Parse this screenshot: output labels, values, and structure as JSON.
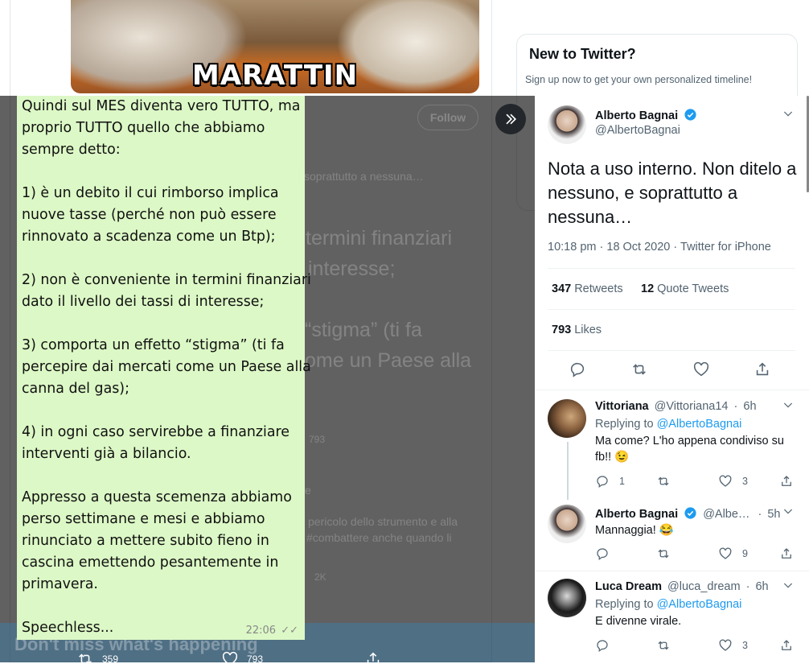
{
  "background": {
    "photo_caption": "MARATTIN",
    "sidebar_title": "New to Twitter?",
    "sidebar_subtitle": "Sign up now to get your own personalized timeline!",
    "follow_label": "Follow",
    "dim_snippets": [
      "soprattutto a nessuna…",
      "termini finanziari",
      "interesse;",
      "“stigma” (ti fa",
      "ome un Paese alla",
      "793",
      "pericolo dello strumento e alla",
      "#combattere anche quando li",
      "2K",
      "e"
    ],
    "banner_text": "Don't miss what's happening"
  },
  "chat_image": {
    "lines": [
      "Quindi sul MES diventa vero TUTTO, ma",
      "proprio TUTTO quello che abbiamo",
      "sempre detto:",
      "",
      "1) è un debito il cui rimborso implica",
      "nuove tasse (perché non può essere",
      "rinnovato a scadenza come un Btp);",
      "",
      "2) non è conveniente in termini finanziari",
      "dato il livello dei tassi di interesse;",
      "",
      "3) comporta un effetto “stigma” (ti fa",
      "percepire dai mercati come un Paese alla",
      "canna del gas);",
      "",
      "4) in ogni caso servirebbe a finanziare",
      "interventi già a bilancio.",
      "",
      "Appresso a questa scemenza abbiamo",
      "perso settimane e mesi e abbiamo",
      "rinunciato a mettere subito fieno in",
      "cascina emettendo pesantemente in",
      "primavera.",
      "",
      "Speechless..."
    ],
    "time": "22:06",
    "ticks": "✓✓"
  },
  "image_viewer_bar": {
    "retweets": "359",
    "likes": "793"
  },
  "tweet": {
    "author_name": "Alberto Bagnai",
    "author_handle": "@AlbertoBagnai",
    "text": "Nota a uso interno. Non ditelo a nessuno, e soprattutto a nessuna…",
    "time": "10:18 pm",
    "date": "18 Oct 2020",
    "source": "Twitter for iPhone",
    "retweets_count": "347",
    "retweets_label": "Retweets",
    "quotes_count": "12",
    "quotes_label": "Quote Tweets",
    "likes_count": "793",
    "likes_label": "Likes"
  },
  "replies": [
    {
      "name": "Vittoriana",
      "handle": "@Vittoriana14",
      "age": "6h",
      "replying_to_label": "Replying to",
      "replying_to": "@AlbertoBagnai",
      "text": "Ma come? L'ho appena condiviso su fb!! 😉",
      "reply_count": "1",
      "retweet_count": "",
      "like_count": "3"
    },
    {
      "name": "Alberto Bagnai",
      "handle": "@Albe…",
      "age": "5h",
      "text": "Mannaggia! 😂",
      "reply_count": "",
      "retweet_count": "",
      "like_count": "9"
    },
    {
      "name": "Luca Dream",
      "handle": "@luca_dream",
      "age": "6h",
      "replying_to_label": "Replying to",
      "replying_to": "@AlbertoBagnai",
      "text": "E divenne virale.",
      "reply_count": "",
      "retweet_count": "",
      "like_count": "3"
    }
  ],
  "separator_dot": "·",
  "colors": {
    "accent": "#1d9bf0",
    "chat_bubble": "#dcf8c6",
    "overlay": "#000000"
  }
}
